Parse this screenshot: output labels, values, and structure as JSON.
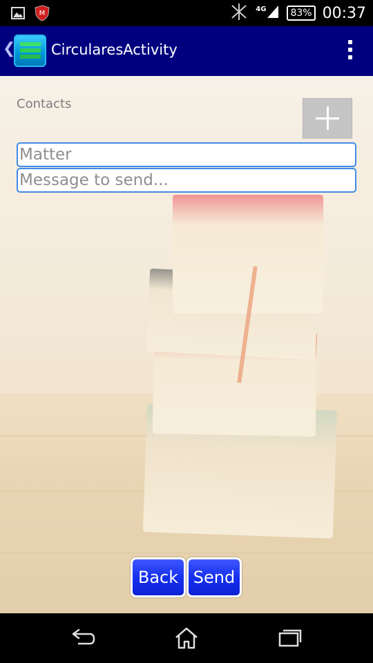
{
  "status_bar": {
    "time": "00:37",
    "battery": "83%",
    "network": "4G",
    "icons": [
      "image-icon",
      "mcafee-icon",
      "no-signal-icon",
      "signal-icon",
      "battery-icon"
    ]
  },
  "action_bar": {
    "title": "CircularesActivity",
    "back_glyph": "❮",
    "icons": [
      "app-logo-icon",
      "overflow-menu-icon"
    ],
    "color": "#00007f"
  },
  "form": {
    "contacts_label": "Contacts",
    "add_button_icon": "plus-icon",
    "matter": {
      "value": "",
      "placeholder": "Matter"
    },
    "message": {
      "value": "",
      "placeholder": "Message to send..."
    }
  },
  "buttons": {
    "back_label": "Back",
    "send_label": "Send",
    "color": "#1630f0"
  },
  "nav_bar": {
    "icons": [
      "back-icon",
      "home-icon",
      "recents-icon"
    ]
  }
}
